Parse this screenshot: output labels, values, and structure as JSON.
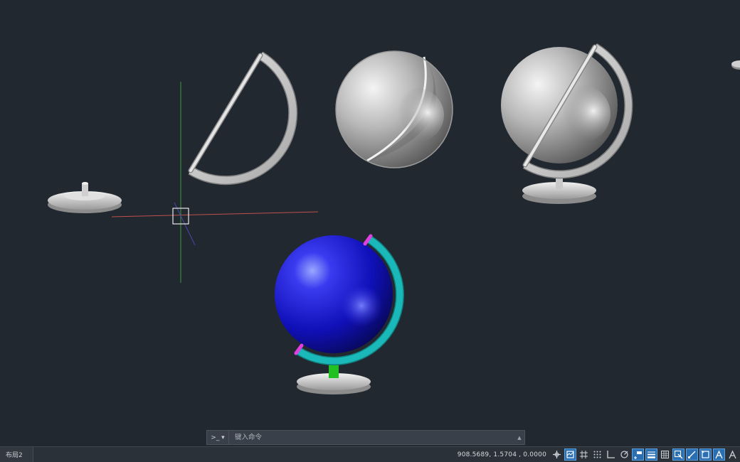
{
  "viewport": {
    "objects": [
      "globe-base-part",
      "meridian-ring-part",
      "hemisphere-shell-part",
      "assembled-globe-gray",
      "assembled-globe-colored"
    ]
  },
  "command_line": {
    "prompt_symbol": ">_ ▾",
    "placeholder": "键入命令",
    "scroll_glyph": "▲"
  },
  "status_bar": {
    "layout_tab": "布局2",
    "coordinates": "908.5689,  1.5704  ,  0.0000",
    "icons": [
      {
        "name": "snap-tracking-icon",
        "on": false
      },
      {
        "name": "model-space-icon",
        "on": true
      },
      {
        "name": "grid-icon",
        "on": false
      },
      {
        "name": "snap-mode-icon",
        "on": false
      },
      {
        "name": "ortho-icon",
        "on": false
      },
      {
        "name": "polar-tracking-icon",
        "on": false
      },
      {
        "name": "dynamic-input-icon",
        "on": true
      },
      {
        "name": "lineweight-icon",
        "on": true
      },
      {
        "name": "transparency-icon",
        "on": false
      },
      {
        "name": "selection-cycling-icon",
        "on": true
      },
      {
        "name": "object-snap-icon",
        "on": true
      },
      {
        "name": "ucs-icon",
        "on": true
      },
      {
        "name": "annotation-visibility-icon",
        "on": true
      },
      {
        "name": "annotation-scale-icon",
        "on": false
      }
    ]
  },
  "colors": {
    "background": "#212830",
    "globe_blue": "#1414c8",
    "ring_cyan": "#1ab8b8",
    "axis_magenta": "#e040e0",
    "stand_green": "#22c022",
    "metal_gray": "#c8c8c8",
    "ucs_x": "#c05050",
    "ucs_y": "#3a9a3a",
    "ucs_z": "#4a4aa8"
  }
}
